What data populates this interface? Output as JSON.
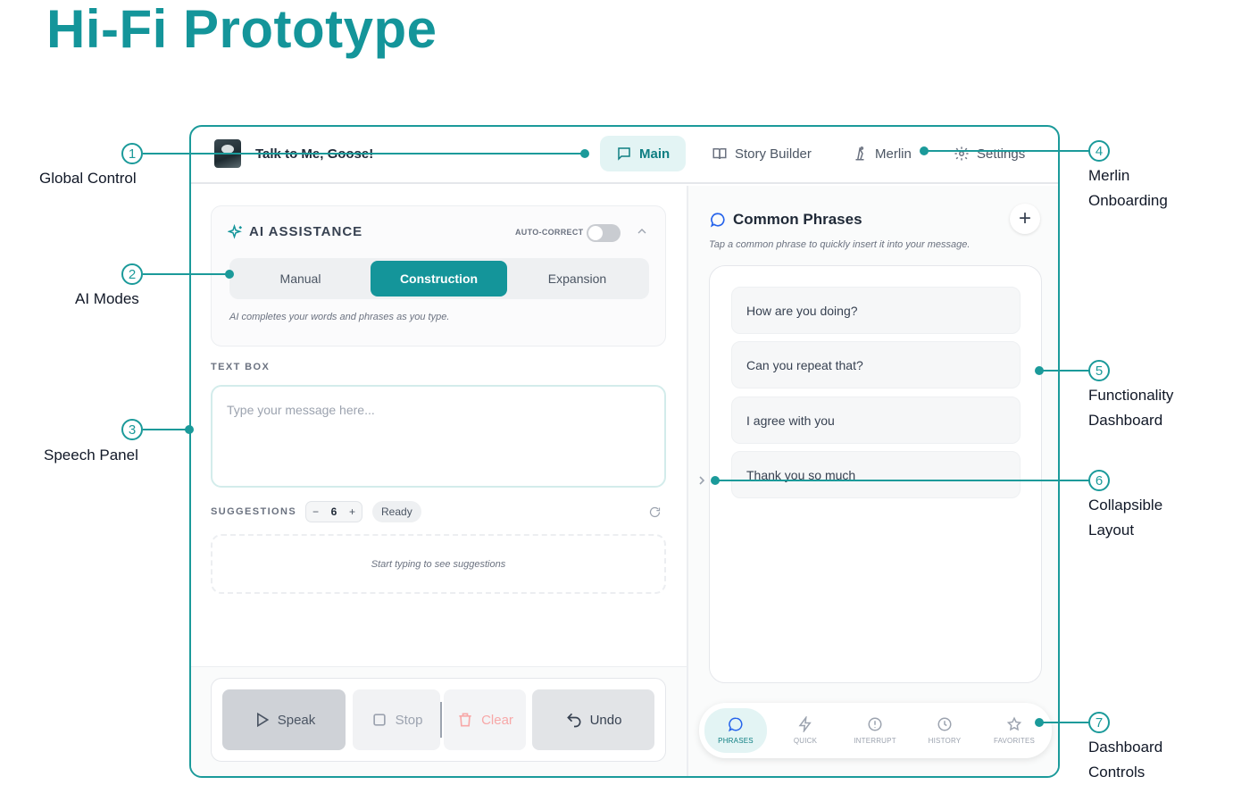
{
  "page_title": "Hi-Fi Prototype",
  "app": {
    "name": "Talk to Me, Goose!",
    "nav": [
      {
        "label": "Main",
        "icon": "message-icon",
        "active": true
      },
      {
        "label": "Story Builder",
        "icon": "book-icon",
        "active": false
      },
      {
        "label": "Merlin",
        "icon": "wizard-icon",
        "active": false
      },
      {
        "label": "Settings",
        "icon": "gear-icon",
        "active": false
      }
    ]
  },
  "ai_assistance": {
    "title": "AI ASSISTANCE",
    "autocorrect_label": "AUTO-CORRECT",
    "autocorrect_on": false,
    "modes": [
      "Manual",
      "Construction",
      "Expansion"
    ],
    "active_mode": "Construction",
    "description": "AI completes your words and phrases as you type."
  },
  "textbox": {
    "label": "TEXT BOX",
    "placeholder": "Type your message here...",
    "value": ""
  },
  "suggestions": {
    "label": "SUGGESTIONS",
    "minus": "−",
    "count": "6",
    "plus": "+",
    "status": "Ready",
    "empty_text": "Start typing to see suggestions"
  },
  "actions": {
    "speak": "Speak",
    "stop": "Stop",
    "clear": "Clear",
    "undo": "Undo"
  },
  "common_phrases": {
    "title": "Common Phrases",
    "add": "+",
    "description": "Tap a common phrase to quickly insert it into your message.",
    "phrases": [
      "How are you doing?",
      "Can you repeat that?",
      "I agree with you",
      "Thank you so much"
    ]
  },
  "dashboard_tabs": [
    {
      "label": "PHRASES",
      "icon": "chat-bubble-icon",
      "active": true
    },
    {
      "label": "QUICK",
      "icon": "lightning-icon",
      "active": false
    },
    {
      "label": "INTERRUPT",
      "icon": "alert-circle-icon",
      "active": false
    },
    {
      "label": "HISTORY",
      "icon": "clock-icon",
      "active": false
    },
    {
      "label": "FAVORITES",
      "icon": "star-icon",
      "active": false
    }
  ],
  "annotations": [
    {
      "number": "1",
      "label": "Global Control"
    },
    {
      "number": "2",
      "label": "AI Modes"
    },
    {
      "number": "3",
      "label": "Speech Panel"
    },
    {
      "number": "4",
      "label": "Merlin Onboarding"
    },
    {
      "number": "5",
      "label": "Functionality Dashboard"
    },
    {
      "number": "6",
      "label": "Collapsible Layout"
    },
    {
      "number": "7",
      "label": "Dashboard Controls"
    }
  ],
  "colors": {
    "accent": "#14959a",
    "accent_light": "#e3f4f4",
    "clear_red": "#f7a8a8"
  }
}
